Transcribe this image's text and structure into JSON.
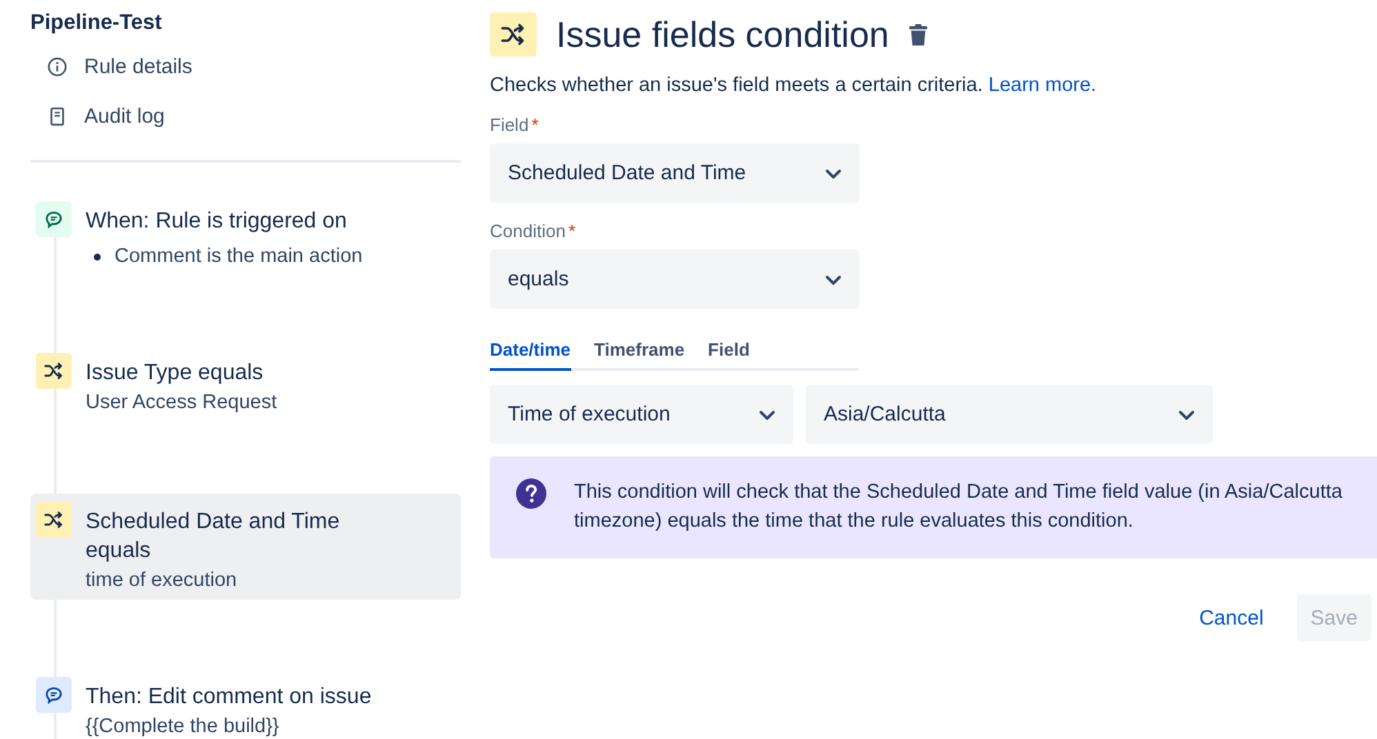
{
  "sidebar": {
    "title": "Pipeline-Test",
    "links": [
      {
        "kind": "info",
        "label": "Rule details"
      },
      {
        "kind": "log",
        "label": "Audit log"
      }
    ],
    "steps": [
      {
        "kind": "trigger",
        "title": "When: Rule is triggered on",
        "bullets": [
          "Comment is the main action"
        ],
        "selected": false
      },
      {
        "kind": "condition",
        "title": "Issue Type equals",
        "detail": "User Access Request",
        "selected": false
      },
      {
        "kind": "condition",
        "title": "Scheduled Date and Time equals",
        "detail": "time of execution",
        "selected": true
      },
      {
        "kind": "action",
        "title": "Then: Edit comment on issue",
        "detail": "{{Complete the build}}",
        "selected": false
      }
    ]
  },
  "panel": {
    "title": "Issue fields condition",
    "description": "Checks whether an issue's field meets a certain criteria.",
    "learn_more": "Learn more.",
    "fields": [
      {
        "label": "Field",
        "required_mark": "*",
        "value": "Scheduled Date and Time"
      },
      {
        "label": "Condition",
        "required_mark": "*",
        "value": "equals"
      }
    ],
    "tabs": [
      {
        "label": "Date/time",
        "selected": true
      },
      {
        "label": "Timeframe",
        "selected": false
      },
      {
        "label": "Field",
        "selected": false
      }
    ],
    "selects": [
      "Time of execution",
      "Asia/Calcutta"
    ],
    "info": "This condition will check that the Scheduled Date and Time field value (in Asia/Calcutta timezone) equals the time that the rule evaluates this condition.",
    "buttons": [
      {
        "label": "Cancel",
        "kind": "link",
        "disabled": false
      },
      {
        "label": "Save",
        "kind": "primary",
        "disabled": true
      }
    ]
  }
}
